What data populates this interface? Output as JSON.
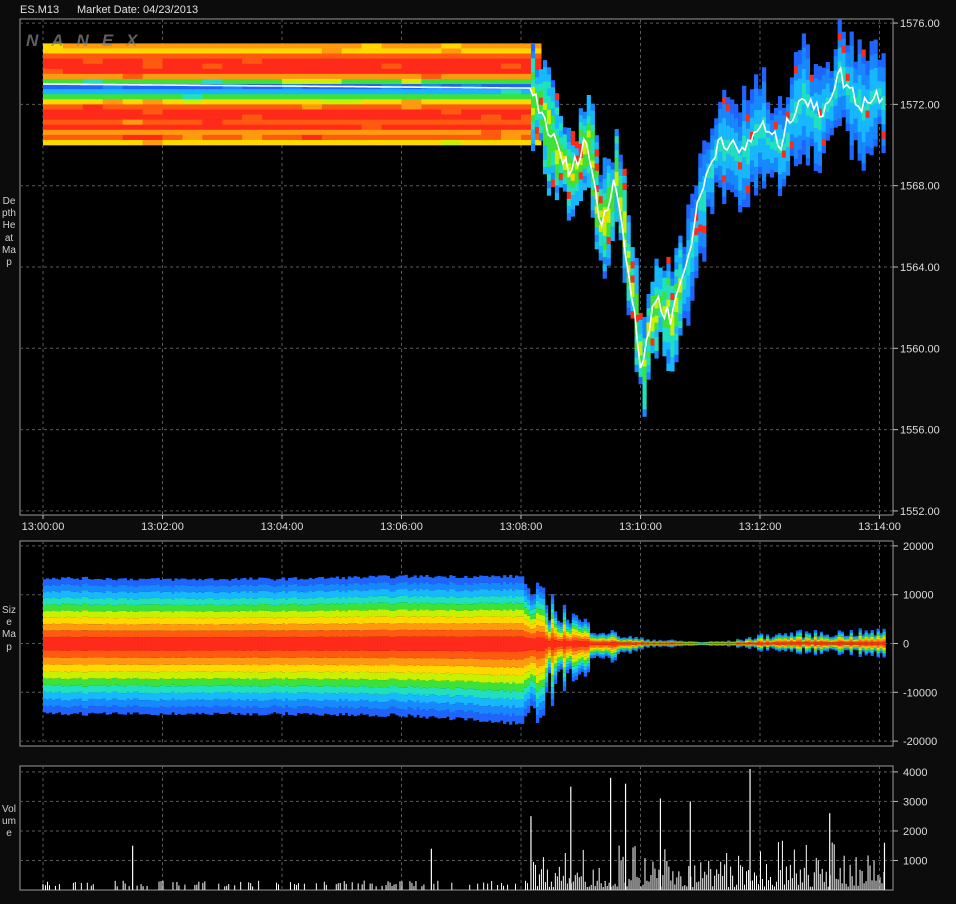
{
  "header": {
    "symbol": "ES.M13",
    "market_date": "Market Date: 04/23/2013"
  },
  "watermark": "NANEX",
  "panels": {
    "depth_label": "Depth Heat Map",
    "size_label": "Size Map",
    "volume_label": "Volume"
  },
  "colors": {
    "background": "#000000",
    "frame": "#0c0c0c",
    "grid": "#5a5a5a",
    "heat_scale": [
      "#ff2a1a",
      "#ff5a10",
      "#ff9a10",
      "#ffd800",
      "#c8f000",
      "#3ce23a",
      "#20e0c0",
      "#18b8ff",
      "#1888ff",
      "#1f64ff"
    ]
  },
  "chart_data": [
    {
      "type": "heatmap",
      "title": "Depth Heat Map",
      "xlabel": "",
      "ylabel": "",
      "x_ticks": [
        "13:00:00",
        "13:02:00",
        "13:04:00",
        "13:06:00",
        "13:08:00",
        "13:10:00",
        "13:12:00",
        "13:14:00"
      ],
      "y_ticks": [
        "1576.00",
        "1572.00",
        "1568.00",
        "1564.00",
        "1560.00",
        "1556.00",
        "1552.00"
      ],
      "ylim": [
        1551.8,
        1576.2
      ],
      "grid": true,
      "price_series": {
        "name": "",
        "x": [
          "13:00:00",
          "13:08:10",
          "13:08:30",
          "13:08:50",
          "13:09:05",
          "13:09:20",
          "13:09:35",
          "13:09:50",
          "13:10:00",
          "13:10:15",
          "13:10:30",
          "13:10:45",
          "13:11:00",
          "13:11:20",
          "13:11:40",
          "13:12:00",
          "13:12:20",
          "13:12:40",
          "13:13:00",
          "13:13:20",
          "13:13:40",
          "13:14:00",
          "13:14:05"
        ],
        "y": [
          1573.0,
          1572.8,
          1570.5,
          1568.5,
          1570.5,
          1566.0,
          1568.5,
          1563.0,
          1559.0,
          1562.5,
          1561.5,
          1564.0,
          1567.5,
          1570.5,
          1569.5,
          1571.0,
          1570.0,
          1572.5,
          1571.5,
          1573.5,
          1572.0,
          1572.5,
          1572.5
        ]
      }
    },
    {
      "type": "area",
      "title": "Size Map",
      "xlabel": "",
      "ylabel": "",
      "y_ticks": [
        "20000",
        "10000",
        "0",
        "-10000",
        "-20000"
      ],
      "ylim": [
        -21000,
        21000
      ],
      "grid": true,
      "series": [
        {
          "name": "",
          "x": [
            "13:00:00",
            "13:02:00",
            "13:04:00",
            "13:06:00",
            "13:08:00",
            "13:08:10",
            "13:08:40",
            "13:09:10",
            "13:09:40",
            "13:10:00",
            "13:10:30",
            "13:11:00",
            "13:11:30",
            "13:12:00",
            "13:12:30",
            "13:13:00",
            "13:13:30",
            "13:14:05"
          ],
          "y": [
            13500,
            13200,
            13300,
            13800,
            13800,
            9500,
            6500,
            3200,
            1500,
            900,
            600,
            300,
            500,
            1500,
            2000,
            2000,
            2200,
            2300
          ]
        },
        {
          "name": "",
          "x": [
            "13:00:00",
            "13:02:00",
            "13:04:00",
            "13:06:00",
            "13:08:00",
            "13:08:10",
            "13:08:40",
            "13:09:10",
            "13:09:40",
            "13:10:00",
            "13:10:30",
            "13:11:00",
            "13:11:30",
            "13:12:00",
            "13:12:30",
            "13:13:00",
            "13:13:30",
            "13:14:05"
          ],
          "y": [
            -14500,
            -14500,
            -14500,
            -14800,
            -16500,
            -12500,
            -8000,
            -4500,
            -2200,
            -900,
            -600,
            -300,
            -500,
            -1200,
            -1500,
            -1800,
            -1900,
            -2200
          ]
        }
      ]
    },
    {
      "type": "bar",
      "title": "Volume",
      "xlabel": "",
      "ylabel": "",
      "y_ticks": [
        "4000",
        "3000",
        "2000",
        "1000"
      ],
      "ylim": [
        0,
        4200
      ],
      "grid": true,
      "series": [
        {
          "name": "",
          "x": [
            "13:00:00",
            "13:01:30",
            "13:06:30",
            "13:08:10",
            "13:08:50",
            "13:09:30",
            "13:09:45",
            "13:10:20",
            "13:10:50",
            "13:11:50",
            "13:13:10",
            "13:14:05"
          ],
          "y": [
            200,
            1500,
            1400,
            2500,
            3500,
            3800,
            3600,
            3100,
            3000,
            4100,
            2600,
            1600
          ]
        }
      ]
    }
  ]
}
